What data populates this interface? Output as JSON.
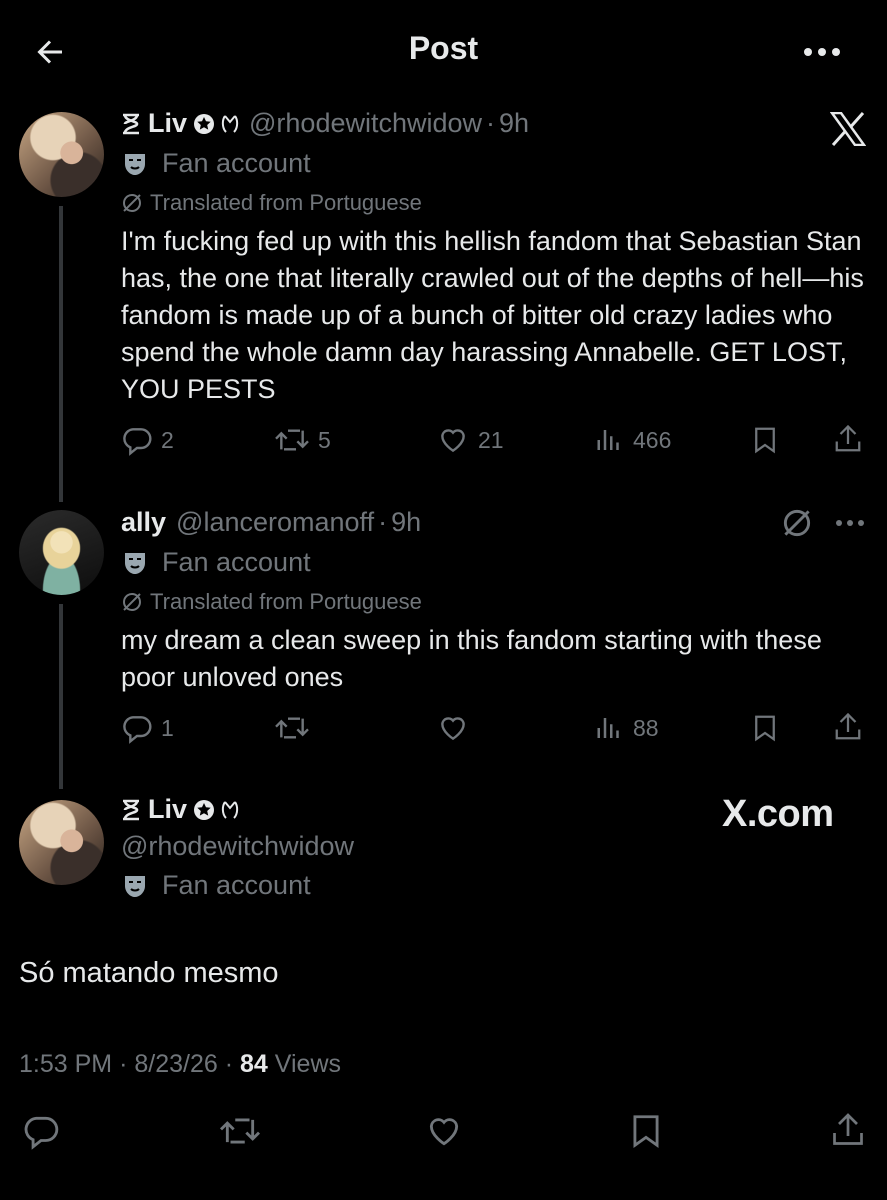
{
  "header": {
    "title": "Post"
  },
  "thread": [
    {
      "name": "Liv",
      "handle": "@rhodewitchwidow",
      "time": "9h",
      "label": "Fan account",
      "translated": "Translated from Portuguese",
      "text": "I'm fucking fed up with this hellish fandom that Sebastian Stan has, the one that literally crawled out of the depths of hell—his fandom is made up of a bunch of bitter old crazy ladies who spend the whole damn day harassing Annabelle. GET LOST, YOU PESTS",
      "stats": {
        "replies": "2",
        "reposts": "5",
        "likes": "21",
        "views": "466"
      }
    },
    {
      "name": "ally",
      "handle": "@lanceromanoff",
      "time": "9h",
      "label": "Fan account",
      "translated": "Translated from Portuguese",
      "text": "my dream a clean sweep in this fandom starting with these poor unloved ones",
      "stats": {
        "replies": "1",
        "views": "88"
      }
    }
  ],
  "main_post": {
    "name": "Liv",
    "handle": "@rhodewitchwidow",
    "label": "Fan account",
    "text": "Só matando mesmo",
    "time": "1:53 PM",
    "date": "8/23/26",
    "views_count": "84",
    "views_label": "Views"
  },
  "watermark": "X.com",
  "colors": {
    "background": "#000000",
    "text": "#e7e9ea",
    "muted": "#71767b",
    "divider": "#333639"
  },
  "icons": [
    "back-arrow-icon",
    "more-icon",
    "x-logo-icon",
    "hourglass-icon",
    "star-badge-icon",
    "moon-icon",
    "mask-icon",
    "translate-icon",
    "reply-icon",
    "repost-icon",
    "like-icon",
    "views-icon",
    "bookmark-icon",
    "share-icon"
  ]
}
